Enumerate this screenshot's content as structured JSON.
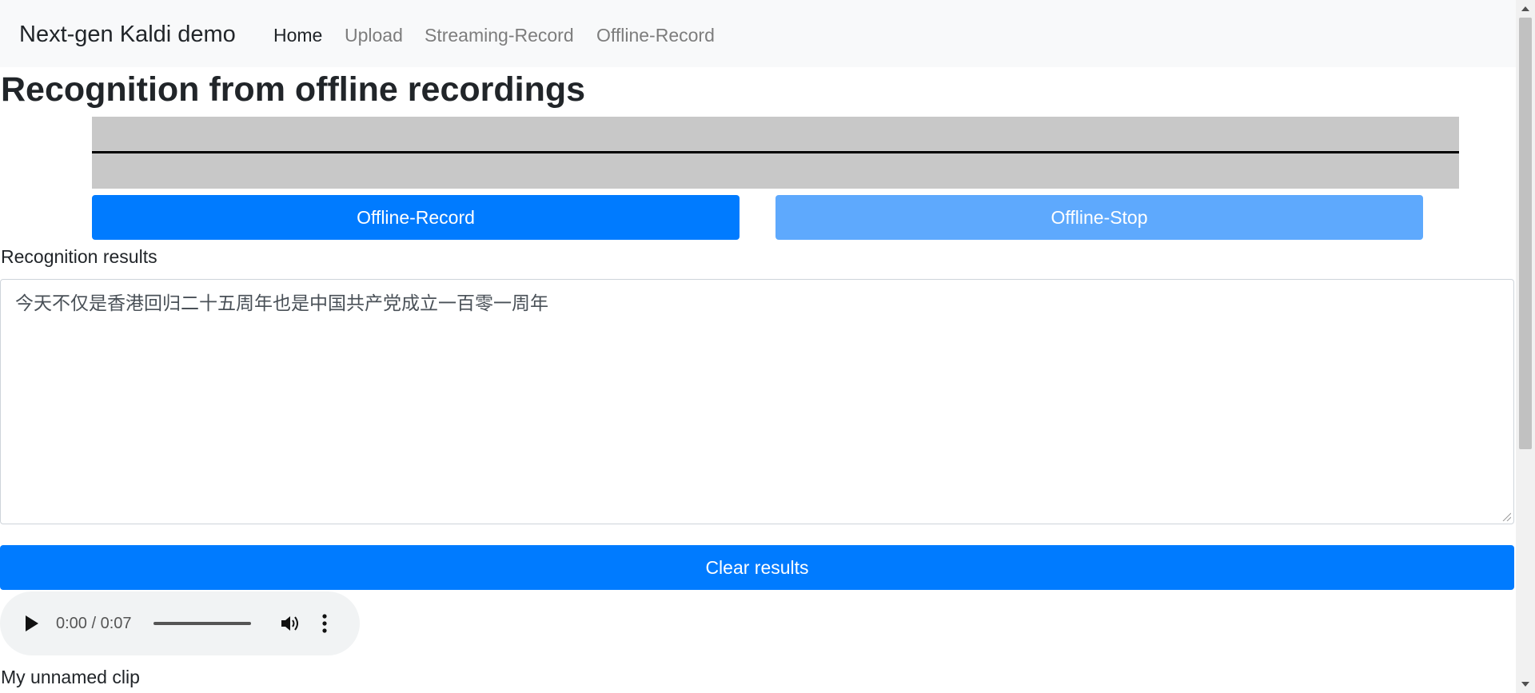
{
  "navbar": {
    "brand": "Next-gen Kaldi demo",
    "items": [
      {
        "label": "Home",
        "active": true
      },
      {
        "label": "Upload",
        "active": false
      },
      {
        "label": "Streaming-Record",
        "active": false
      },
      {
        "label": "Offline-Record",
        "active": false
      }
    ]
  },
  "page": {
    "title": "Recognition from offline recordings"
  },
  "controls": {
    "record_label": "Offline-Record",
    "stop_label": "Offline-Stop"
  },
  "results": {
    "label": "Recognition results",
    "text": "今天不仅是香港回归二十五周年也是中国共产党成立一百零一周年",
    "clear_label": "Clear results"
  },
  "audio": {
    "time": "0:00 / 0:07",
    "progress": 0,
    "icons": {
      "play": "play-icon",
      "volume": "volume-icon",
      "more": "more-vertical-icon"
    }
  },
  "clip": {
    "name": "My unnamed clip"
  },
  "colors": {
    "primary": "#007bff",
    "primary_disabled": "#5ea9fd",
    "navbar_bg": "#f8f9fa",
    "canvas_bg": "#c8c8c8"
  }
}
